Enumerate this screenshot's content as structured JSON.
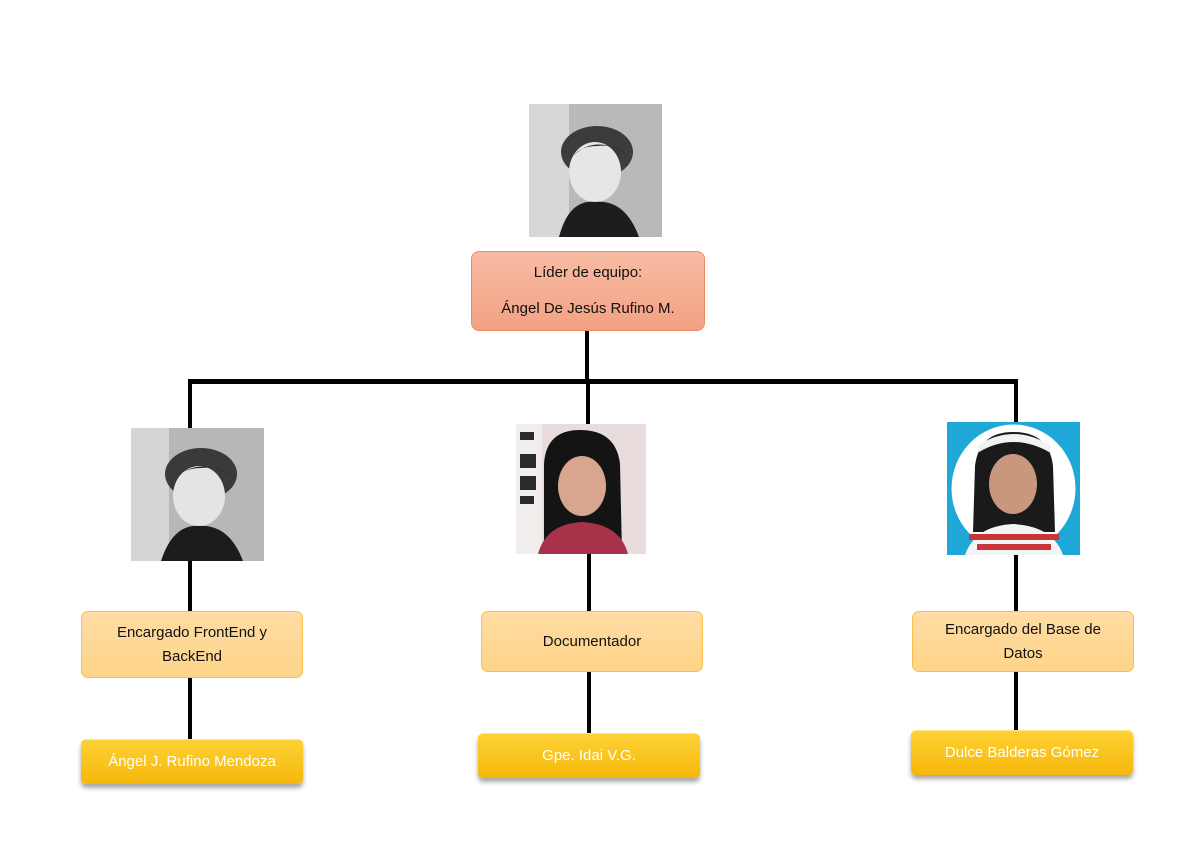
{
  "leader": {
    "role_label": "Líder de equipo:",
    "name": "Ángel De Jesús Rufino M."
  },
  "members": [
    {
      "role": "Encargado FrontEnd y BackEnd",
      "name": "Ángel J. Rufino Mendoza"
    },
    {
      "role": "Documentador",
      "name": "Gpe. Idai V.G."
    },
    {
      "role": "Encargado del Base de Datos",
      "name": "Dulce Balderas Gómez"
    }
  ],
  "colors": {
    "leader_box": "#f3a183",
    "role_box": "#fdd489",
    "name_box": "#f6b70a",
    "connector": "#000000"
  }
}
